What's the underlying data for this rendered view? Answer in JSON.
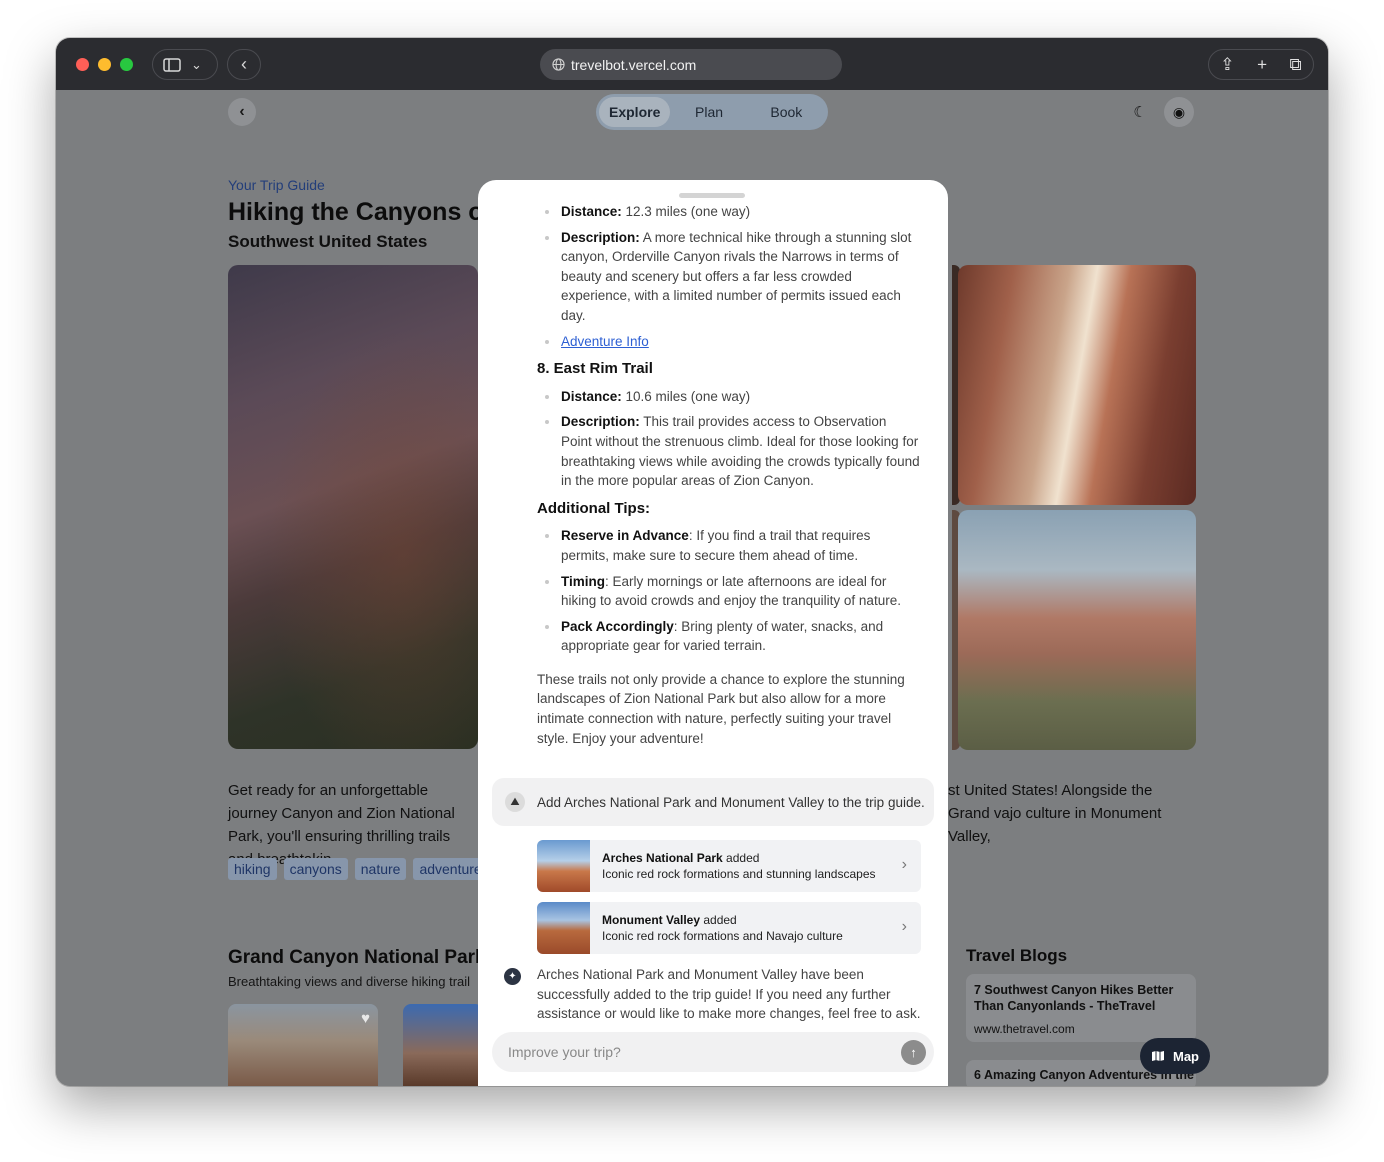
{
  "browser": {
    "url": "trevelbot.vercel.com"
  },
  "nav": {
    "back_icon": "chevron-left-icon",
    "tabs": [
      {
        "label": "Explore",
        "active": true
      },
      {
        "label": "Plan",
        "active": false
      },
      {
        "label": "Book",
        "active": false
      }
    ],
    "theme_icon": "moon-icon",
    "account_icon": "user-circle-icon"
  },
  "page": {
    "kicker": "Your Trip Guide",
    "title": "Hiking the Canyons of",
    "subtitle": "Southwest United States",
    "intro_left": "Get ready for an unforgettable journey Canyon and Zion National Park, you'll ensuring thrilling trails and breathtakin",
    "intro_right": "st United States! Alongside the Grand vajo culture in Monument Valley,",
    "tags": [
      "hiking",
      "canyons",
      "nature",
      "adventure"
    ],
    "section_title": "Grand Canyon National Parl",
    "section_subtitle": "Breathtaking views and diverse hiking trail",
    "blogs_title": "Travel Blogs",
    "blogs": [
      {
        "title": "7 Southwest Canyon Hikes Better Than Canyonlands - TheTravel",
        "url": "www.thetravel.com"
      },
      {
        "title": "6 Amazing Canyon Adventures in the"
      }
    ],
    "map_button": "Map"
  },
  "chat": {
    "items_top": [
      {
        "label": "Distance:",
        "text": " 12.3 miles (one way)"
      },
      {
        "label": "Description:",
        "text": " A more technical hike through a stunning slot canyon, Orderville Canyon rivals the Narrows in terms of beauty and scenery but offers a far less crowded experience, with a limited number of permits issued each day."
      }
    ],
    "adventure_link": "Adventure Info",
    "trail8_title": "8. East Rim Trail",
    "items_trail8": [
      {
        "label": "Distance:",
        "text": " 10.6 miles (one way)"
      },
      {
        "label": "Description:",
        "text": " This trail provides access to Observation Point without the strenuous climb. Ideal for those looking for breathtaking views while avoiding the crowds typically found in the more popular areas of Zion Canyon."
      }
    ],
    "tips_title": "Additional Tips:",
    "tips": [
      {
        "label": "Reserve in Advance",
        "text": ": If you find a trail that requires permits, make sure to secure them ahead of time."
      },
      {
        "label": "Timing",
        "text": ": Early mornings or late afternoons are ideal for hiking to avoid crowds and enjoy the tranquility of nature."
      },
      {
        "label": "Pack Accordingly",
        "text": ": Bring plenty of water, snacks, and appropriate gear for varied terrain."
      }
    ],
    "closing": "These trails not only provide a chance to explore the stunning landscapes of Zion National Park but also allow for a more intimate connection with nature, perfectly suiting your travel style. Enjoy your adventure!",
    "user_message": "Add Arches National Park and Monument Valley to the trip guide.",
    "added_cards": [
      {
        "name": "Arches National Park",
        "suffix": " added",
        "desc": "Iconic red rock formations and stunning landscapes"
      },
      {
        "name": "Monument Valley",
        "suffix": " added",
        "desc": "Iconic red rock formations and Navajo culture"
      }
    ],
    "bot_message": "Arches National Park and Monument Valley have been successfully added to the trip guide! If you need any further assistance or would like to make more changes, feel free to ask.",
    "input_placeholder": "Improve your trip?",
    "input_value": ""
  }
}
